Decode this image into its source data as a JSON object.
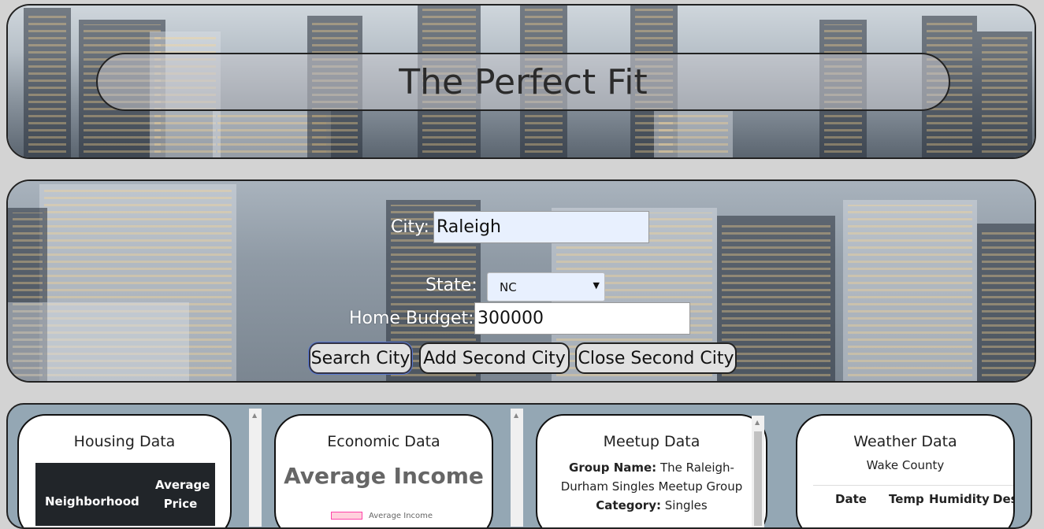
{
  "header": {
    "title": "The Perfect Fit"
  },
  "search": {
    "city_label": "City:",
    "city_value": "Raleigh",
    "state_label": "State:",
    "state_value": "NC",
    "budget_label": "Home Budget:",
    "budget_value": "300000",
    "buttons": {
      "search": "Search City",
      "add": "Add Second City",
      "close": "Close Second City"
    }
  },
  "cards": {
    "housing": {
      "title": "Housing Data",
      "columns": [
        "Neighborhood",
        "Average Price"
      ]
    },
    "economic": {
      "title": "Economic Data",
      "heading": "Average Income",
      "legend": "Average Income"
    },
    "meetup": {
      "title": "Meetup Data",
      "group_label": "Group Name:",
      "group_value": "The Raleigh-Durham Singles Meetup Group",
      "category_label": "Category:",
      "category_value": "Singles"
    },
    "weather": {
      "title": "Weather Data",
      "county": "Wake County",
      "columns": [
        "Date",
        "Temp",
        "Humidity",
        "Descr"
      ]
    }
  },
  "icons": {
    "select_arrow": "chevron-down-icon",
    "scroll_up": "scroll-up-icon"
  }
}
